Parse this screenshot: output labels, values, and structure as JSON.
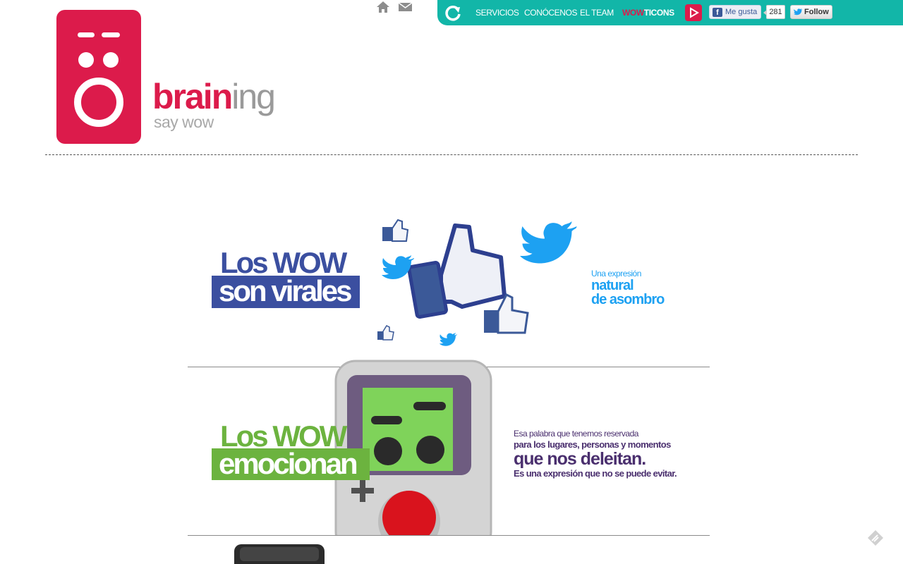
{
  "header": {
    "brand_strong": "brain",
    "brand_light": "ing",
    "tagline": "say wow",
    "logo_icon": "braining-logo-icon",
    "home_icon": "home-icon",
    "mail_icon": "mail-icon"
  },
  "nav": {
    "refresh_icon": "refresh-icon",
    "items": [
      {
        "label": "SERVICIOS"
      },
      {
        "label": "CONÓCENOS"
      },
      {
        "label": "EL TEAM"
      }
    ],
    "wow_prefix": "WOW",
    "wow_suffix": "TICONS",
    "play_icon": "play-icon",
    "facebook_label": "Me gusta",
    "facebook_count": "281",
    "twitter_label": "Follow"
  },
  "sections": [
    {
      "line1": "Los WOW",
      "line2": "son virales",
      "side_small": "Una expresión",
      "side_big1": "natural",
      "side_big2": "de asombro"
    },
    {
      "line1": "Los WOW",
      "line2": "emocionan",
      "side_small": "Esa palabra que tenemos reservada",
      "side_mid": "para los lugares, personas y momentos",
      "side_big": "que nos deleitan.",
      "side_end": "Es una expresión que no se puede evitar."
    }
  ],
  "colors": {
    "brand_pink": "#dc1b4b",
    "nav_teal": "#12b6a8",
    "viral_blue": "#3b4fa0",
    "twitter_blue": "#1da1f2",
    "emotion_green": "#6cb33f",
    "purple": "#4a2f6e"
  }
}
